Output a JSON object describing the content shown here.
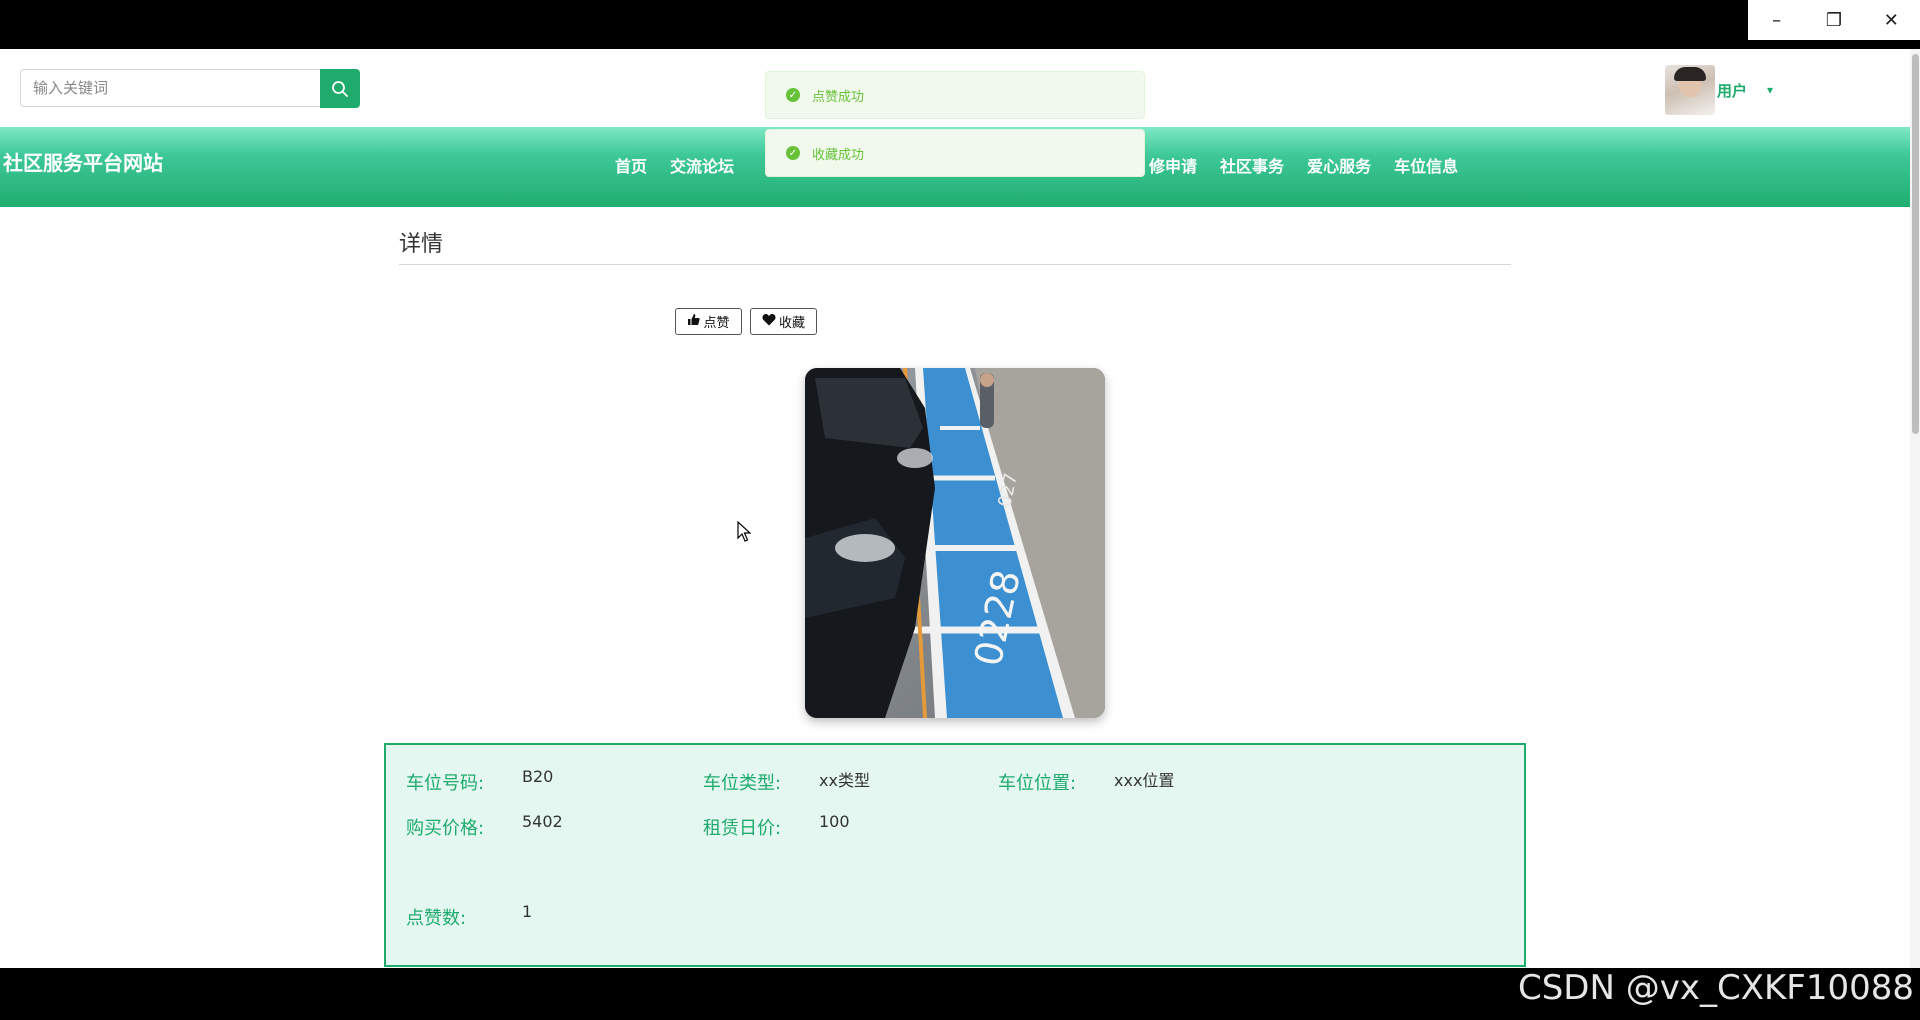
{
  "window": {
    "minimize": "–",
    "restore": "❐",
    "close": "✕"
  },
  "header": {
    "search_placeholder": "输入关键词",
    "search_icon": "search-icon",
    "user_name": "用户",
    "user_caret": "▾"
  },
  "toasts": [
    {
      "message": "点赞成功"
    },
    {
      "message": "收藏成功"
    }
  ],
  "navbar": {
    "site_title": "社区服务平台网站",
    "items": [
      {
        "label": "首页"
      },
      {
        "label": "交流论坛"
      },
      {
        "label": "修申请"
      },
      {
        "label": "社区事务"
      },
      {
        "label": "爱心服务"
      },
      {
        "label": "车位信息"
      }
    ]
  },
  "detail": {
    "title": "详情",
    "like_button": "点赞",
    "favorite_button": "收藏",
    "photo_alt": "共享车位 0228"
  },
  "info": {
    "fields": [
      {
        "label": "车位号码:",
        "value": "B20"
      },
      {
        "label": "车位类型:",
        "value": "xx类型"
      },
      {
        "label": "车位位置:",
        "value": "xxx位置"
      },
      {
        "label": "购买价格:",
        "value": "5402"
      },
      {
        "label": "租赁日价:",
        "value": "100"
      },
      {
        "label": "点赞数:",
        "value": "1"
      }
    ]
  },
  "watermark": "CSDN @vx_CXKF10088",
  "colors": {
    "accent": "#1fab6c",
    "toast_success": "#67c23a",
    "info_bg": "#e4f7f1"
  }
}
